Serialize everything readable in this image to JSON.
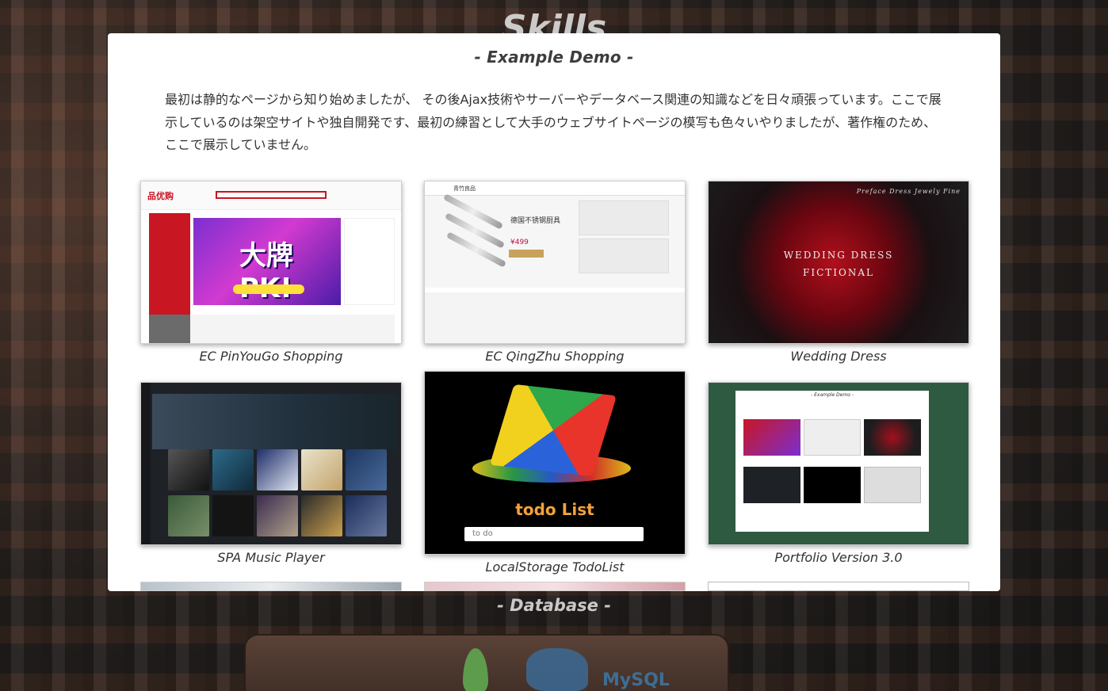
{
  "background": {
    "section_title": "Skills",
    "database_title": "- Database -",
    "mysql_logo_text": "MySQL"
  },
  "modal": {
    "title": "- Example Demo -",
    "intro": "最初は静的なページから知り始めましたが、 その後Ajax技術やサーバーやデータベース関連の知識などを日々頑張っています。ここで展示しているのは架空サイトや独自開発です、最初の練習として大手のウェブサイトページの模写も色々いやりましたが、著作権のため、ここで展示していません。",
    "projects": [
      {
        "caption": "EC PinYouGo Shopping",
        "thumb_text": "大牌PK!",
        "logo": "品优购"
      },
      {
        "caption": "EC QingZhu Shopping",
        "thumb_text": "德国不锈钢厨具",
        "logo": "青竹良品"
      },
      {
        "caption": "Wedding Dress",
        "thumb_text": "WEDDING DRESS",
        "thumb_subtext": "FICTIONAL",
        "thumb_menu": "Preface  Dress  Jewely  Fine"
      },
      {
        "caption": "SPA Music Player"
      },
      {
        "caption": "LocalStorage TodoList",
        "thumb_text": "todo List",
        "thumb_input": "to do"
      },
      {
        "caption": "Portfolio Version 3.0",
        "thumb_text": "- Example Demo -"
      }
    ]
  },
  "colors": {
    "modal_bg": "#ffffff",
    "title_text": "#3d3d3d",
    "pinyougo_red": "#c81623",
    "todo_orange": "#f2a23a",
    "portfolio_green": "#2d5a40"
  }
}
